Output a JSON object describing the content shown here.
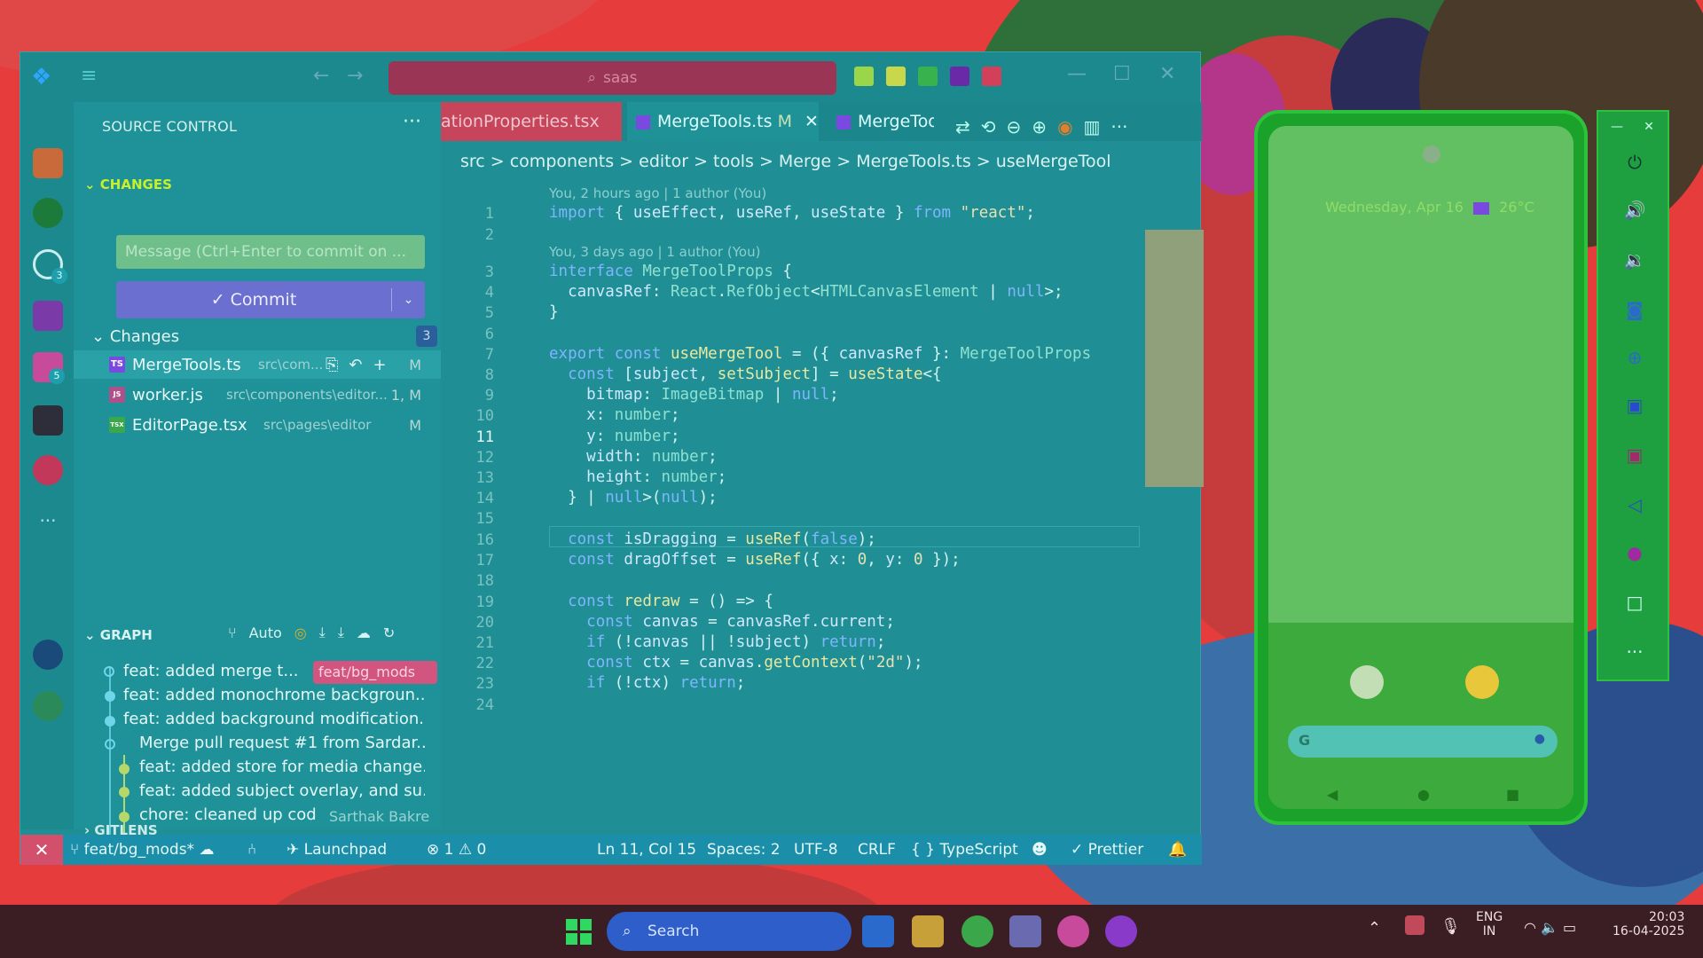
{
  "window": {
    "search": "saas"
  },
  "sidebar": {
    "title": "SOURCE CONTROL",
    "changes_section": "CHANGES",
    "message_placeholder": "Message (Ctrl+Enter to commit on ...",
    "commit_label": "✓ Commit",
    "changes_group": "Changes",
    "changes_count": "3",
    "files": [
      {
        "name": "MergeTools.ts",
        "path": "src\\com...",
        "status": "M",
        "type": "TS"
      },
      {
        "name": "worker.js",
        "path": "src\\components\\editor...",
        "status": "1, M",
        "type": "JS"
      },
      {
        "name": "EditorPage.tsx",
        "path": "src\\pages\\editor",
        "status": "M",
        "type": "TSX"
      }
    ],
    "graph_title": "GRAPH",
    "graph_auto": "Auto",
    "branch_tag": "feat/bg_mods",
    "commits": [
      "feat: added merge t...",
      "feat: added monochrome backgroun...",
      "feat: added background modification...",
      "Merge pull request #1 from Sardar...",
      "feat: added store for media change...",
      "feat: added subject overlay, and su...",
      "chore: cleaned up code"
    ],
    "last_author": "Sarthak Bakre",
    "gitlens": "GITLENS",
    "badges": {
      "scm": "3",
      "extensions": "5"
    }
  },
  "editor": {
    "tabs": [
      {
        "label": "ationProperties.tsx",
        "state": "inactive"
      },
      {
        "label": "MergeTools.ts",
        "mod": "M",
        "state": "active"
      },
      {
        "label": "MergeToo",
        "state": "preview"
      }
    ],
    "breadcrumb": "src  >  components  >  editor  >  tools  >  Merge  >   MergeTools.ts  >   useMergeTool",
    "blame1": "You, 2 hours ago | 1 author (You)",
    "blame2": "You, 3 days ago | 1 author (You)",
    "line_numbers": [
      "1",
      "2",
      "3",
      "4",
      "5",
      "6",
      "7",
      "8",
      "9",
      "10",
      "11",
      "12",
      "13",
      "14",
      "15",
      "16",
      "17",
      "18",
      "19",
      "20",
      "21",
      "22",
      "23",
      "24"
    ],
    "current_line": "11"
  },
  "status": {
    "branch": "feat/bg_mods*",
    "launchpad": "Launchpad",
    "problems": "⊗ 1  ⚠ 0",
    "position": "Ln 11, Col 15",
    "spaces": "Spaces: 2",
    "encoding": "UTF-8",
    "eol": "CRLF",
    "language": "{ }  TypeScript",
    "prettier": "✓ Prettier"
  },
  "phone": {
    "date": "Wednesday, Apr 16",
    "weather": "26°C"
  },
  "taskbar": {
    "search": "Search",
    "lang": "ENG",
    "region": "IN",
    "time": "20:03",
    "date": "16-04-2025"
  },
  "colors": {
    "editor_bg": "#1f8f95",
    "accent": "#c6f02a",
    "commit": "#6b6fcf"
  }
}
